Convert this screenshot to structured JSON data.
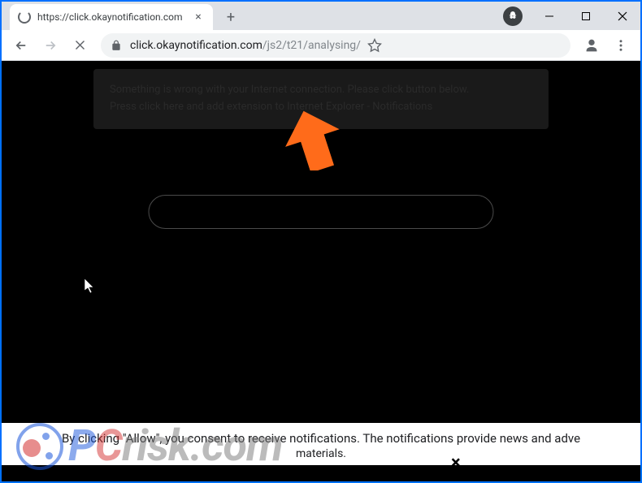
{
  "tab": {
    "title": "https://click.okaynotification.com"
  },
  "url": {
    "domain": "click.okaynotification.com",
    "path": "/js2/t21/analysing/"
  },
  "darkBanner": {
    "line1": "Something is wrong with your Internet connection. Please click button below.",
    "line2": "Press click here and add extension to Internet Explorer - Notifications"
  },
  "consent": {
    "text": "By clicking \"Allow\", you consent to receive notifications. The notifications provide news and adve",
    "sub": "materials."
  },
  "watermark": {
    "p": "P",
    "c": "C",
    "rest": "risk.com"
  }
}
